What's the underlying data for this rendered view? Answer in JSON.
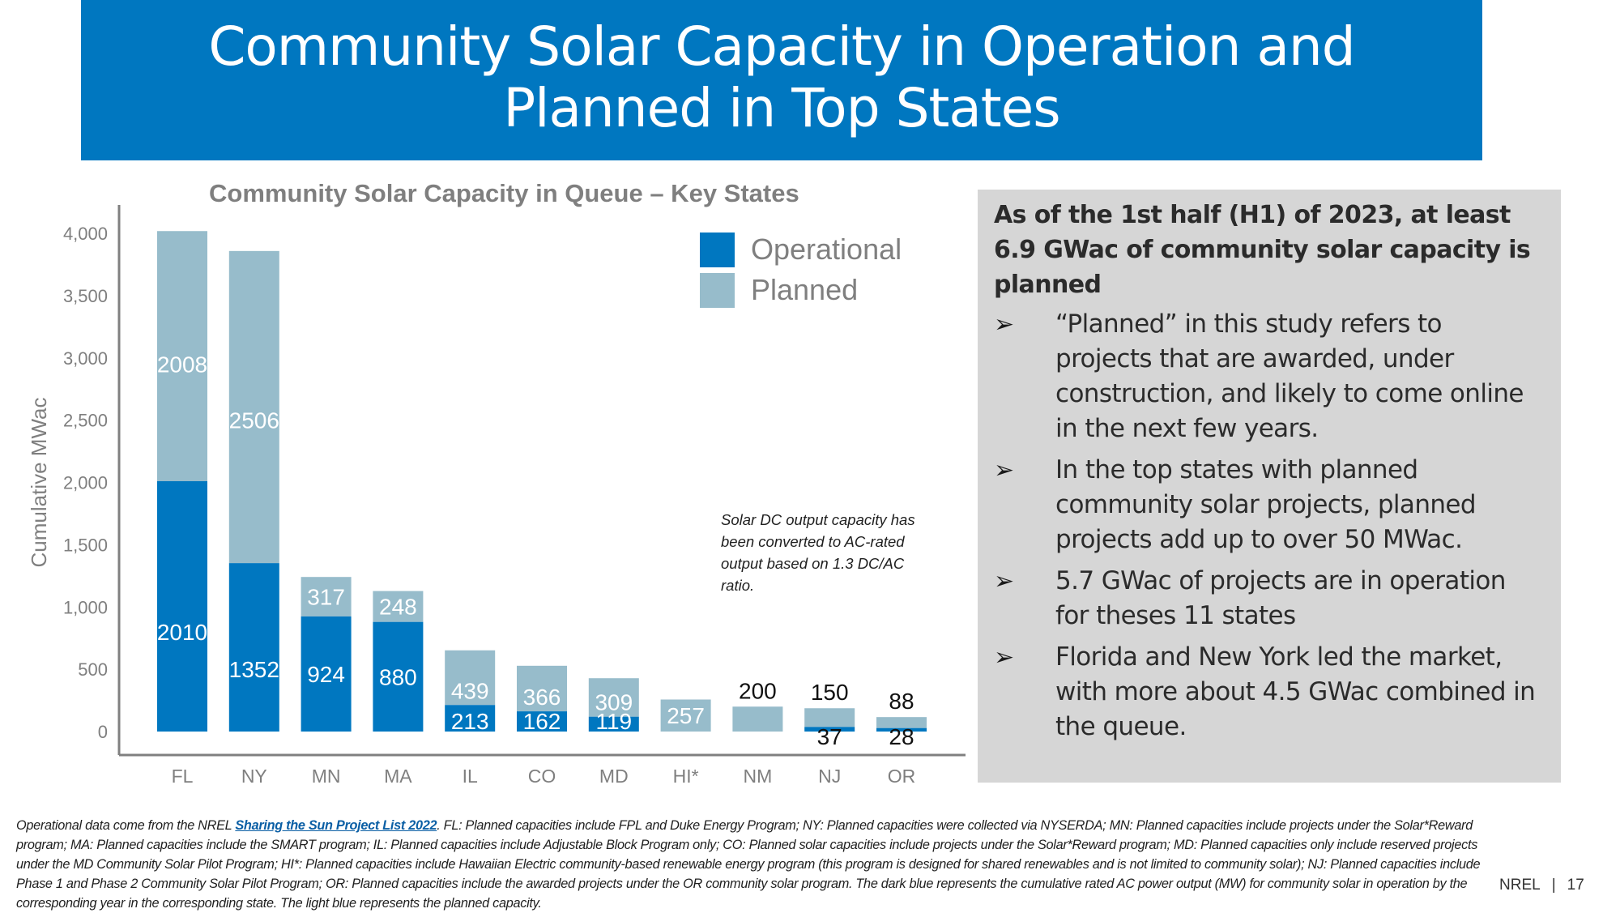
{
  "slide": {
    "title": "Community Solar Capacity in Operation and Planned in Top States",
    "brand_color": "#0077c0"
  },
  "chart_data": {
    "type": "bar",
    "stacked": true,
    "title": "Community Solar Capacity in Queue – Key States",
    "xlabel": "",
    "ylabel": "Cumulative MWac",
    "ylim": [
      0,
      4000
    ],
    "yticks": [
      0,
      500,
      1000,
      1500,
      2000,
      2500,
      3000,
      3500,
      4000
    ],
    "ytick_labels": [
      "0",
      "500",
      "1,000",
      "1,500",
      "2,000",
      "2,500",
      "3,000",
      "3,500",
      "4,000"
    ],
    "grid": false,
    "legend_position": "top-right",
    "categories": [
      "FL",
      "NY",
      "MN",
      "MA",
      "IL",
      "CO",
      "MD",
      "HI*",
      "NM",
      "NJ",
      "OR"
    ],
    "series": [
      {
        "name": "Operational",
        "color": "#0077c0",
        "values": [
          2010,
          1352,
          924,
          880,
          213,
          162,
          119,
          0,
          0,
          37,
          28
        ]
      },
      {
        "name": "Planned",
        "color": "#97bccb",
        "values": [
          2008,
          2506,
          317,
          248,
          439,
          366,
          309,
          257,
          200,
          150,
          88
        ]
      }
    ],
    "data_labels": {
      "Operational": [
        "2010",
        "1352",
        "924",
        "880",
        "213",
        "162",
        "119",
        "",
        "",
        "37",
        "28"
      ],
      "Planned": [
        "2008",
        "2506",
        "317",
        "248",
        "439",
        "366",
        "309",
        "257",
        "200",
        "150",
        "88"
      ]
    },
    "annotation": "Solar DC output capacity has been converted to AC-rated output based on 1.3 DC/AC ratio."
  },
  "panel": {
    "heading": "As of the 1st half (H1) of 2023, at least 6.9 GWac of community solar capacity is planned",
    "bullet_icon": "arrowhead-bullet",
    "bullets": [
      "“Planned” in this study refers to projects that are awarded, under construction, and  likely to come online in the next few years.",
      "In the top states with planned community solar projects, planned projects add up to over 50 MWac.",
      "5.7 GWac of projects are in operation for theses 11 states",
      "Florida and New York led the market, with more about 4.5 GWac combined in the queue."
    ]
  },
  "footnote": {
    "prefix": "Operational data come from the NREL ",
    "link_text": "Sharing the Sun Project List 2022",
    "suffix": ". FL: Planned capacities include FPL and Duke Energy Program; NY: Planned capacities were collected via NYSERDA; MN: Planned capacities include projects under the Solar*Reward program; MA: Planned capacities include the SMART program; IL: Planned capacities include Adjustable Block Program only; CO: Planned solar capacities include projects under the Solar*Reward program; MD: Planned capacities only include reserved projects under the MD Community Solar Pilot Program; HI*: Planned capacities include Hawaiian Electric community-based renewable energy program (this program is designed for shared renewables and is not limited to community solar); NJ: Planned capacities include Phase 1 and Phase 2 Community Solar Pilot Program; OR: Planned capacities include the awarded projects under the OR community solar program. The dark blue represents the cumulative rated AC power output (MW) for community solar in operation by the corresponding year in the corresponding state. The light blue represents the planned capacity."
  },
  "pager": {
    "org": "NREL",
    "separator": "|",
    "page_number": "17"
  }
}
